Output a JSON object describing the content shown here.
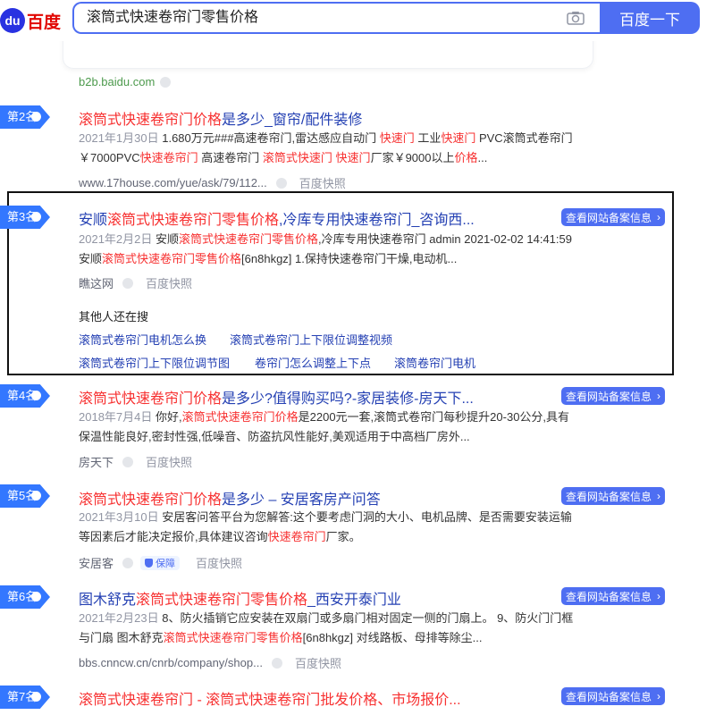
{
  "header": {
    "logo_du": "du",
    "logo_text": "百度",
    "query": "滚筒式快速卷帘门零售价格",
    "search_button": "百度一下"
  },
  "prev_result": {
    "domain": "b2b.baidu.com"
  },
  "results": [
    {
      "rank": "第2名",
      "title_parts": [
        [
          "滚筒式快速卷帘门价格",
          true
        ],
        [
          "是多少_窗帘/配件装修",
          false
        ]
      ],
      "line1": [
        [
          "2021年1月30日",
          "date"
        ],
        [
          " 1.680万元###高速卷帘门,雷达感应自动门 ",
          ""
        ],
        [
          "快速门",
          "hl"
        ],
        [
          " 工业",
          ""
        ],
        [
          "快速门",
          "hl"
        ],
        [
          " PVC滚筒式卷帘门",
          ""
        ]
      ],
      "line2": [
        [
          "￥7000PVC",
          ""
        ],
        [
          "快速卷帘门",
          "hl"
        ],
        [
          " 高速卷帘门 ",
          ""
        ],
        [
          "滚筒式快速门",
          "hl"
        ],
        [
          " ",
          ""
        ],
        [
          "快速门",
          "hl"
        ],
        [
          "厂家￥9000以上",
          ""
        ],
        [
          "价格",
          "hl"
        ],
        [
          "...",
          ""
        ]
      ],
      "source": "www.17house.com/yue/ask/79/112...",
      "snapshot": "百度快照"
    },
    {
      "rank": "第3名",
      "title_parts": [
        [
          "安顺",
          false
        ],
        [
          "滚筒式快速卷帘门零售价格",
          true
        ],
        [
          ",冷库专用快速卷帘门_咨询西...",
          false
        ]
      ],
      "record": "查看网站备案信息",
      "line1": [
        [
          "2021年2月2日",
          "date"
        ],
        [
          " 安顺",
          ""
        ],
        [
          "滚筒式快速卷帘门零售价格",
          "hl"
        ],
        [
          ",冷库专用快速卷帘门 admin 2021-02-02 14:41:59",
          ""
        ]
      ],
      "line2": [
        [
          "安顺",
          ""
        ],
        [
          "滚筒式快速卷帘门零售价格",
          "hl"
        ],
        [
          "[6n8hkgz] 1.保持快速卷帘门干燥,电动机...",
          ""
        ]
      ],
      "source": "瞧这网",
      "snapshot": "百度快照",
      "also_search": {
        "title": "其他人还在搜",
        "links": [
          "滚筒式卷帘门电机怎么换",
          "滚筒式卷帘门上下限位调整视频",
          "滚筒式卷帘门上下限位调节图",
          "卷帘门怎么调整上下点",
          "滚筒卷帘门电机"
        ]
      }
    },
    {
      "rank": "第4名",
      "title_parts": [
        [
          "滚筒式快速卷帘门价格",
          true
        ],
        [
          "是多少?值得购买吗?-家居装修-房天下...",
          false
        ]
      ],
      "record": "查看网站备案信息",
      "line1": [
        [
          "2018年7月4日",
          "date"
        ],
        [
          " 你好,",
          ""
        ],
        [
          "滚筒式快速卷帘门价格",
          "hl"
        ],
        [
          "是2200元一套,滚筒式卷帘门每秒提升20-30公分,具有",
          ""
        ]
      ],
      "line2": [
        [
          "保温性能良好,密封性强,低噪音、防盗抗风性能好,美观适用于中高档厂房外...",
          ""
        ]
      ],
      "source": "房天下",
      "snapshot": "百度快照"
    },
    {
      "rank": "第5名",
      "title_parts": [
        [
          "滚筒式快速卷帘门价格",
          true
        ],
        [
          "是多少 – 安居客房产问答",
          false
        ]
      ],
      "record": "查看网站备案信息",
      "line1": [
        [
          "2021年3月10日",
          "date"
        ],
        [
          " 安居客问答平台为您解答:这个要考虑门洞的大小、电机品牌、是否需要安装运输",
          ""
        ]
      ],
      "line2": [
        [
          "等因素后才能决定报价,具体建议咨询",
          ""
        ],
        [
          "快速卷帘门",
          "hl"
        ],
        [
          "厂家。",
          ""
        ]
      ],
      "source": "安居客",
      "verify": "保障",
      "snapshot": "百度快照"
    },
    {
      "rank": "第6名",
      "title_parts": [
        [
          "图木舒克",
          false
        ],
        [
          "滚筒式快速卷帘门零售价格",
          true
        ],
        [
          "_西安开泰门业",
          false
        ]
      ],
      "record": "查看网站备案信息",
      "line1": [
        [
          "2021年2月23日",
          "date"
        ],
        [
          " 8、防火插销它应安装在双扇门或多扇门相对固定一侧的门扇上。 9、防火门门框",
          ""
        ]
      ],
      "line2": [
        [
          "与门扇 图木舒克",
          ""
        ],
        [
          "滚筒式快速卷帘门零售价格",
          "hl"
        ],
        [
          "[6n8hkgz] 对线路板、母排等除尘...",
          ""
        ]
      ],
      "source": "bbs.cnncw.cn/cnrb/company/shop...",
      "snapshot": "百度快照"
    },
    {
      "rank": "第7名",
      "title_parts": [
        [
          "滚筒式快速卷帘门 - 滚筒式快速卷帘门批发价格、市场报价...",
          true
        ]
      ],
      "record": "查看网站备案信息"
    }
  ],
  "colors": {
    "accent": "#4e6ef2",
    "title_link": "#2440b3",
    "highlight": "#f73131",
    "rank_badge": "#3377ff"
  }
}
